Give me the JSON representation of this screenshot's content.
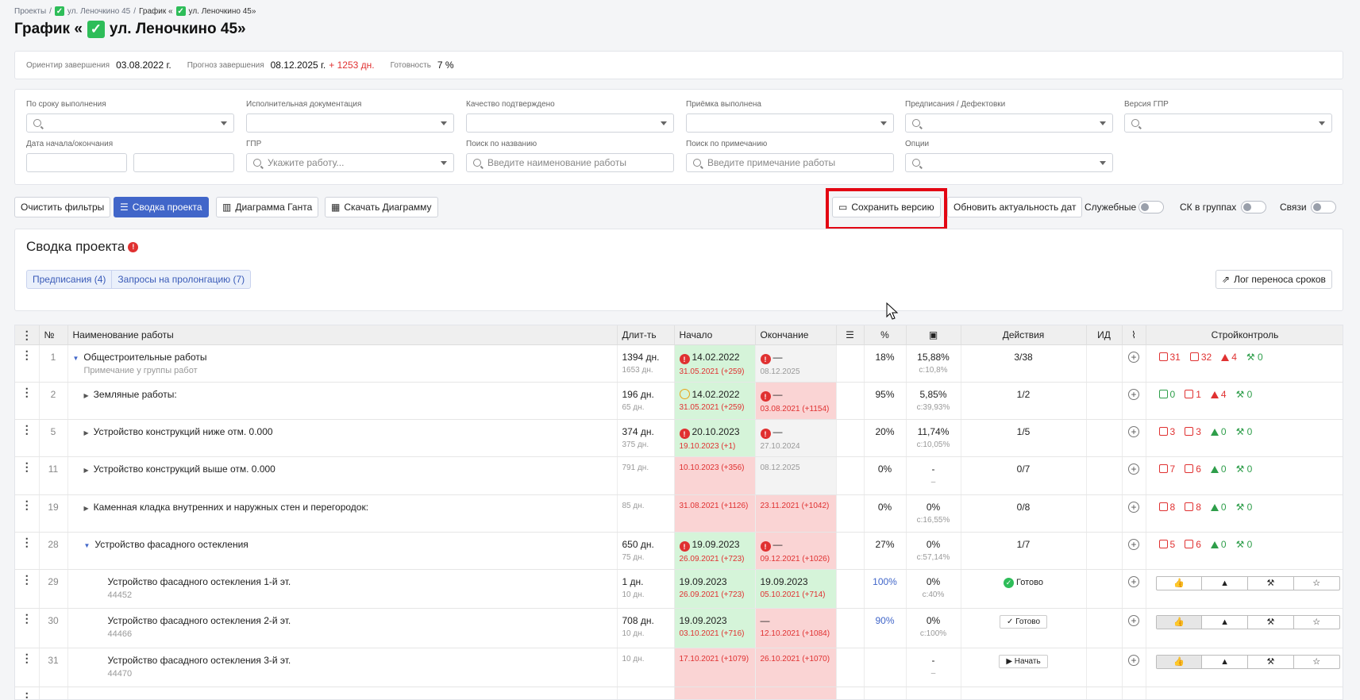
{
  "breadcrumbs": {
    "root": "Проекты",
    "project": "ул. Леночкино 45",
    "current_prefix": "График «",
    "current_name": "ул. Леночкино 45»"
  },
  "page_title": {
    "prefix": "График «",
    "name": "ул. Леночкино 45»"
  },
  "summary": {
    "target_label": "Ориентир завершения",
    "target_value": "03.08.2022 г.",
    "forecast_label": "Прогноз завершения",
    "forecast_value": "08.12.2025 г.",
    "forecast_delta": "+ 1253 дн.",
    "ready_label": "Готовность",
    "ready_value": "7 %"
  },
  "filters": {
    "deadline": "По сроку выполнения",
    "exec_docs": "Исполнительная документация",
    "quality": "Качество подтверждено",
    "acceptance": "Приёмка выполнена",
    "prescriptions": "Предписания / Дефектовки",
    "gpr_version": "Версия ГПР",
    "dates": "Дата начала/окончания",
    "gpr": "ГПР",
    "gpr_placeholder": "Укажите работу...",
    "search_name": "Поиск по названию",
    "search_name_placeholder": "Введите наименование работы",
    "search_note": "Поиск по примечанию",
    "search_note_placeholder": "Введите примечание работы",
    "options": "Опции"
  },
  "toolbar": {
    "clear": "Очистить фильтры",
    "summary": "Сводка проекта",
    "gantt": "Диаграмма Ганта",
    "download": "Скачать Диаграмму",
    "save_version": "Сохранить версию",
    "refresh_dates": "Обновить актуальность дат",
    "service": "Служебные",
    "sk_groups": "СК в группах",
    "links": "Связи"
  },
  "project_summary": {
    "title": "Сводка проекта",
    "tab_prescriptions": "Предписания (4)",
    "tab_prolongation": "Запросы на пролонгацию (7)",
    "log_button": "Лог переноса сроков"
  },
  "table": {
    "headers": {
      "no": "№",
      "name": "Наименование работы",
      "dur": "Длит-ть",
      "start": "Начало",
      "end": "Окончание",
      "pct": "%",
      "actions": "Действия",
      "id": "ИД",
      "sk": "Стройконтроль"
    },
    "rows": [
      {
        "no": "1",
        "name": "Общестроительные работы",
        "note": "Примечание у группы работ",
        "dur": "1394 дн.",
        "dur2": "1653 дн.",
        "start": "14.02.2022",
        "start2": "31.05.2021 (+259)",
        "end": "—",
        "end2": "08.12.2025",
        "pct": "18%",
        "cost": "15,88%",
        "cost2": "с:10,8%",
        "act": "3/38",
        "s1": "31",
        "s2": "32",
        "s3": "4",
        "s4": "0"
      },
      {
        "no": "2",
        "name": "Земляные работы:",
        "dur": "196 дн.",
        "dur2": "65 дн.",
        "start": "14.02.2022",
        "start2": "31.05.2021 (+259)",
        "end": "—",
        "end2": "03.08.2021 (+1154)",
        "pct": "95%",
        "cost": "5,85%",
        "cost2": "с:39,93%",
        "act": "1/2",
        "s1": "0",
        "s2": "1",
        "s3": "4",
        "s4": "0"
      },
      {
        "no": "5",
        "name": "Устройство конструкций ниже отм. 0.000",
        "dur": "374 дн.",
        "dur2": "375 дн.",
        "start": "20.10.2023",
        "start2": "19.10.2023 (+1)",
        "end": "—",
        "end2": "27.10.2024",
        "pct": "20%",
        "cost": "11,74%",
        "cost2": "с:10,05%",
        "act": "1/5",
        "s1": "3",
        "s2": "3",
        "s3": "0",
        "s4": "0"
      },
      {
        "no": "11",
        "name": "Устройство конструкций выше отм. 0.000",
        "dur2": "791 дн.",
        "start2": "10.10.2023 (+356)",
        "end2": "08.12.2025",
        "pct": "0%",
        "cost": "-",
        "cost2": "–",
        "act": "0/7",
        "s1": "7",
        "s2": "6",
        "s3": "0",
        "s4": "0"
      },
      {
        "no": "19",
        "name": "Каменная кладка внутренних и наружных стен и перегородок:",
        "dur2": "85 дн.",
        "start2": "31.08.2021 (+1126)",
        "end2": "23.11.2021 (+1042)",
        "pct": "0%",
        "cost": "0%",
        "cost2": "с:16,55%",
        "act": "0/8",
        "s1": "8",
        "s2": "8",
        "s3": "0",
        "s4": "0"
      },
      {
        "no": "28",
        "name": "Устройство фасадного остекления",
        "dur": "650 дн.",
        "dur2": "75 дн.",
        "start": "19.09.2023",
        "start2": "26.09.2021 (+723)",
        "end": "—",
        "end2": "09.12.2021 (+1026)",
        "pct": "27%",
        "cost": "0%",
        "cost2": "с:57,14%",
        "act": "1/7",
        "s1": "5",
        "s2": "6",
        "s3": "0",
        "s4": "0"
      },
      {
        "no": "29",
        "name": "Устройство фасадного остекления 1-й эт.",
        "note": "44452",
        "dur": "1 дн.",
        "dur2": "10 дн.",
        "start": "19.09.2023",
        "start2": "26.09.2021 (+723)",
        "end": "19.09.2023",
        "end2": "05.10.2021 (+714)",
        "pct": "100%",
        "cost": "0%",
        "cost2": "с:40%",
        "act": "Готово"
      },
      {
        "no": "30",
        "name": "Устройство фасадного остекления 2-й эт.",
        "note": "44466",
        "dur": "708 дн.",
        "dur2": "10 дн.",
        "start": "19.09.2023",
        "start2": "03.10.2021 (+716)",
        "end": "—",
        "end2": "12.10.2021 (+1084)",
        "pct": "90%",
        "cost": "0%",
        "cost2": "с:100%",
        "act": "Готово"
      },
      {
        "no": "31",
        "name": "Устройство фасадного остекления 3-й эт.",
        "note": "44470",
        "dur2": "10 дн.",
        "start2": "17.10.2021 (+1079)",
        "end2": "26.10.2021 (+1070)",
        "cost": "-",
        "cost2": "–",
        "act": "Начать"
      }
    ]
  }
}
